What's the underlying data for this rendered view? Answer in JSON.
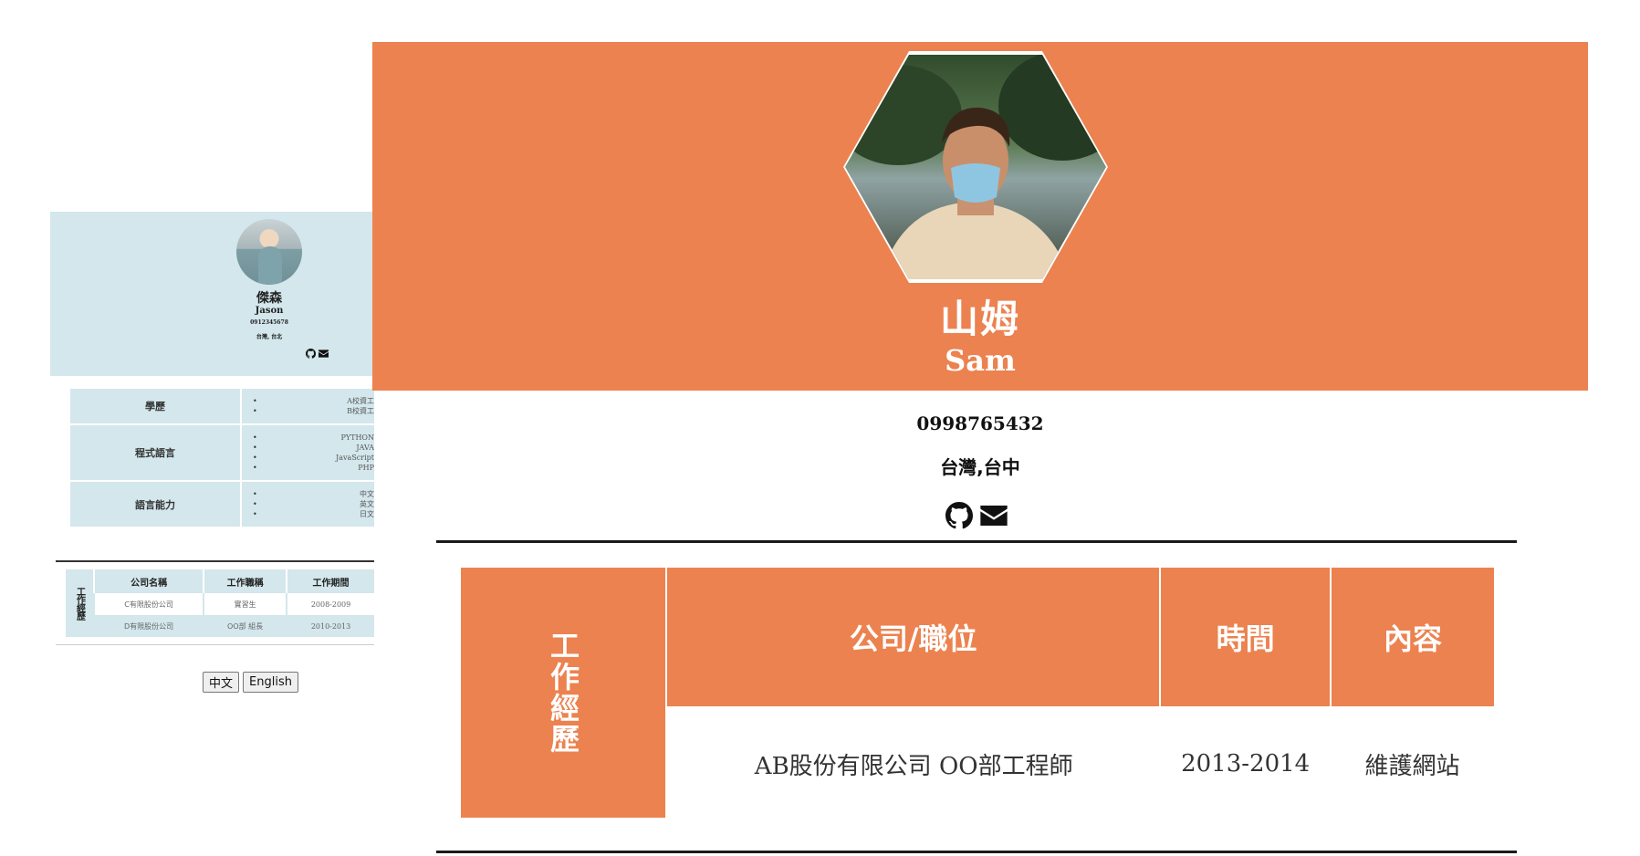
{
  "small": {
    "name_zh": "傑森",
    "name_en": "Jason",
    "phone": "0912345678",
    "address": "台灣, 台北",
    "icons": [
      "github-icon",
      "envelope-icon"
    ],
    "skills": [
      {
        "label": "學歷",
        "items": [
          "A校資工",
          "B校資工"
        ]
      },
      {
        "label": "程式語言",
        "items": [
          "PYTHON",
          "JAVA",
          "JavaScript",
          "PHP"
        ]
      },
      {
        "label": "語言能力",
        "items": [
          "中文",
          "英文",
          "日文"
        ]
      }
    ],
    "work": {
      "side_label": "工作經歷",
      "headers": [
        "公司名稱",
        "工作職稱",
        "工作期間"
      ],
      "rows": [
        [
          "C有限股份公司",
          "實習生",
          "2008-2009"
        ],
        [
          "D有限股份公司",
          "OO部 組長",
          "2010-2013"
        ]
      ]
    }
  },
  "lang_buttons": {
    "zh": "中文",
    "en": "English"
  },
  "big": {
    "name_zh": "山姆",
    "name_en": "Sam",
    "phone": "0998765432",
    "address": "台灣,台中",
    "icons": [
      "github-icon",
      "envelope-icon"
    ],
    "work": {
      "side_label": "工作經歷",
      "headers": [
        "公司/職位",
        "時間",
        "內容"
      ],
      "rows": [
        [
          "AB股份有限公司 OO部工程師",
          "2013-2014",
          "維護網站"
        ]
      ]
    }
  },
  "colors": {
    "accent": "#ec824f",
    "light_blue": "#d3e7ec"
  }
}
